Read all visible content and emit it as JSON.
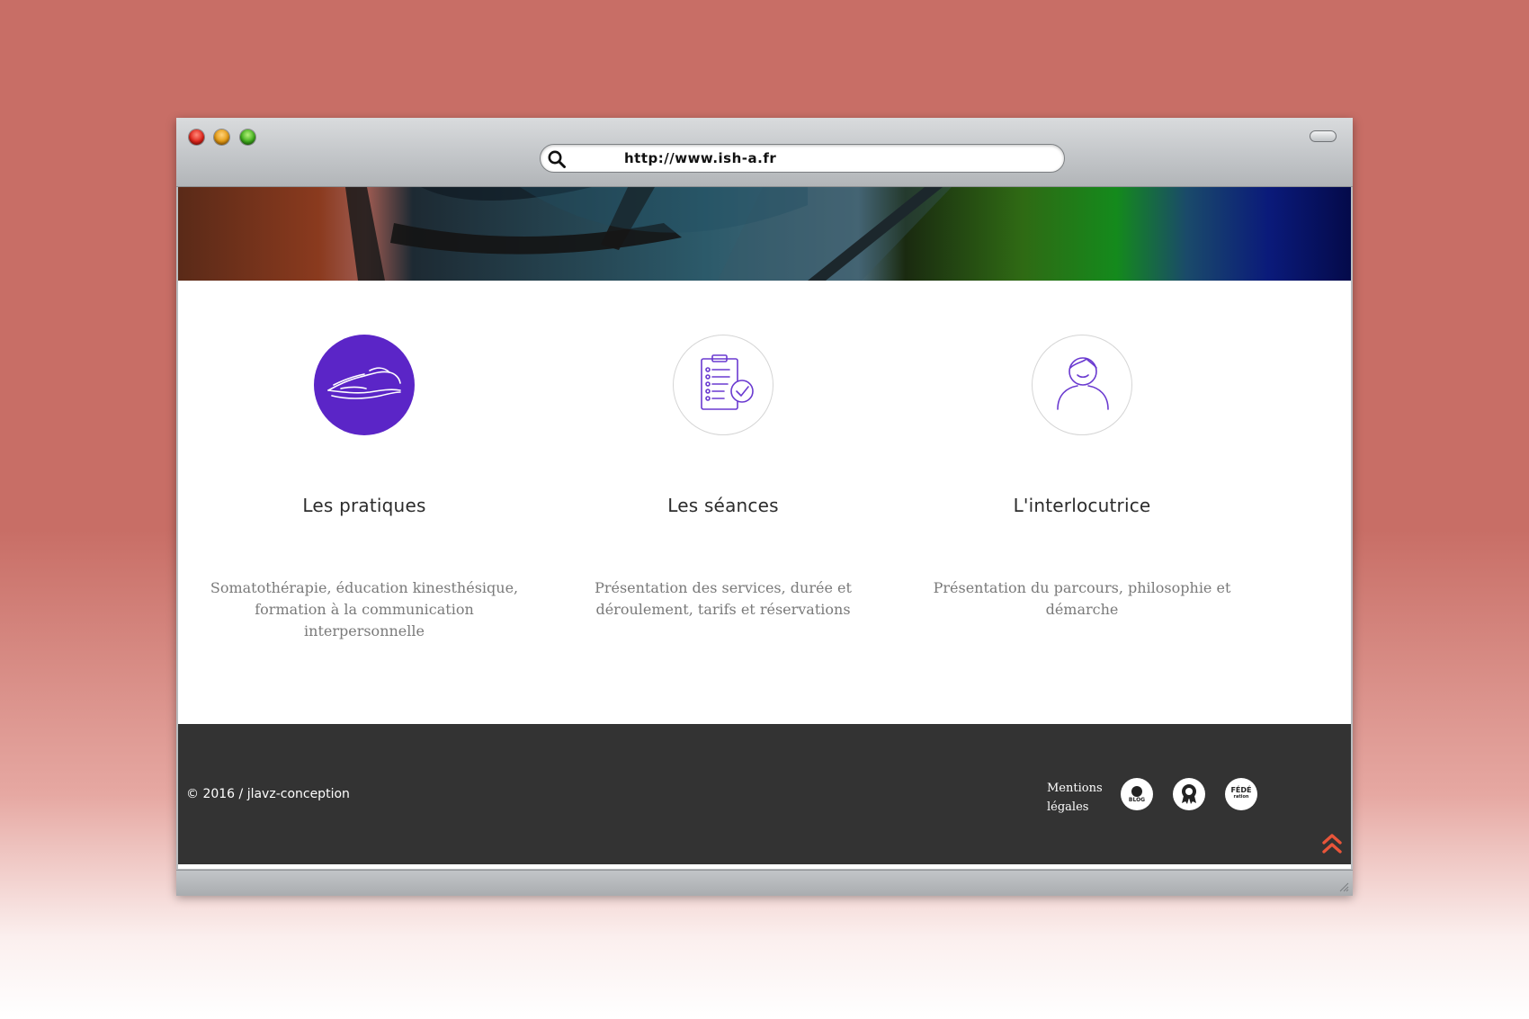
{
  "browser": {
    "url": "http://www.ish-a.fr"
  },
  "features": [
    {
      "icon": "hands-icon",
      "title": "Les pratiques",
      "description": "Somatothérapie, éducation kinesthésique, formation à la communication interpersonnelle"
    },
    {
      "icon": "clipboard-checklist-icon",
      "title": "Les séances",
      "description": "Présentation des services, durée et déroulement, tarifs et réservations"
    },
    {
      "icon": "person-icon",
      "title": "L'interlocutrice",
      "description": "Présentation du parcours, philosophie et démarche"
    }
  ],
  "footer": {
    "copyright": "© 2016 / jlavz-conception",
    "mentions_label": "Mentions légales",
    "social": [
      {
        "icon": "blog-icon",
        "label": "BLOG"
      },
      {
        "icon": "award-icon",
        "label": ""
      },
      {
        "icon": "federation-icon",
        "label_top": "FÉDÉ",
        "label_bottom": "ration"
      }
    ],
    "back_to_top_icon": "double-chevron-up-icon"
  },
  "colors": {
    "accent_purple": "#5b25c7",
    "footer_bg": "#333333",
    "back_to_top": "#e8553a",
    "page_background": "#c86e66"
  }
}
